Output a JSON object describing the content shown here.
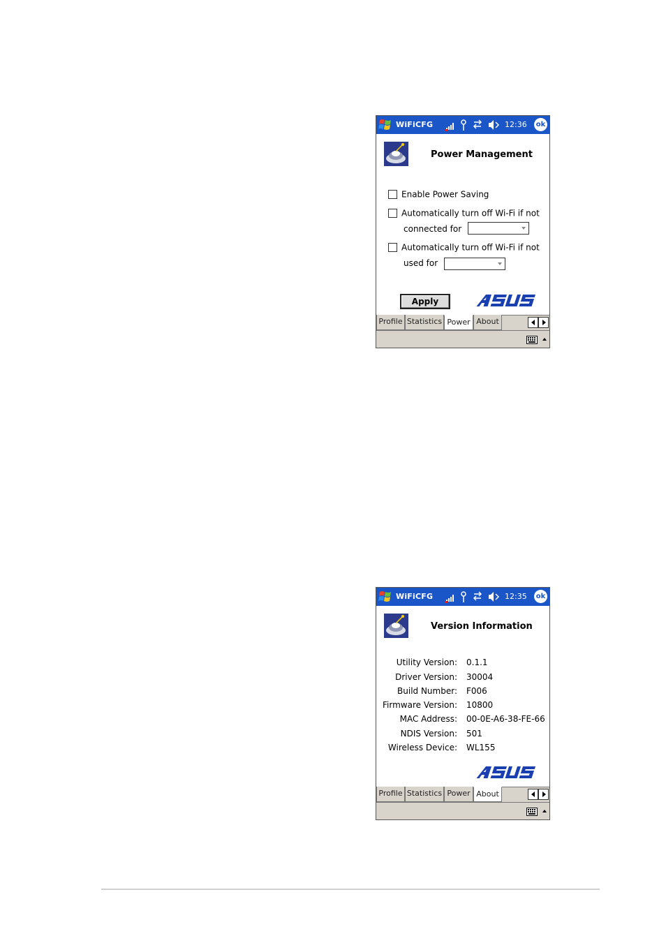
{
  "power_screen": {
    "app_title": "WiFiCFG",
    "time": "12:36",
    "ok_label": "ok",
    "page_title": "Power Management",
    "enable_power_saving": {
      "label": "Enable Power Saving",
      "checked": false
    },
    "auto_off_not_connected": {
      "label": "Automatically turn off Wi-Fi if not",
      "sub_label": "connected for",
      "checked": false,
      "selected": ""
    },
    "auto_off_not_used": {
      "label": "Automatically turn off Wi-Fi if not",
      "sub_label": "used for",
      "checked": false,
      "selected": ""
    },
    "apply_label": "Apply",
    "tabs": [
      "Profile",
      "Statistics",
      "Power",
      "About"
    ],
    "active_tab": "Power"
  },
  "about_screen": {
    "app_title": "WiFiCFG",
    "time": "12:35",
    "ok_label": "ok",
    "page_title": "Version Information",
    "info": [
      {
        "label": "Utility Version:",
        "value": "0.1.1"
      },
      {
        "label": "Driver Version:",
        "value": "30004"
      },
      {
        "label": "Build Number:",
        "value": "F006"
      },
      {
        "label": "Firmware Version:",
        "value": "10800"
      },
      {
        "label": "MAC Address:",
        "value": "00-0E-A6-38-FE-66"
      },
      {
        "label": "NDIS Version:",
        "value": "501"
      },
      {
        "label": "Wireless Device:",
        "value": "WL155"
      }
    ],
    "tabs": [
      "Profile",
      "Statistics",
      "Power",
      "About"
    ],
    "active_tab": "About"
  },
  "icons": [
    "windows-start-icon",
    "signal-strength-icon",
    "antenna-icon",
    "connectivity-icon",
    "volume-icon",
    "wifi-utility-icon",
    "asus-logo",
    "scroll-left-icon",
    "scroll-right-icon",
    "keyboard-icon"
  ],
  "colors": {
    "titlebar": "#1a56c8",
    "asus_logo": "#1a3fb0",
    "tabbar": "#d8d4cc"
  }
}
